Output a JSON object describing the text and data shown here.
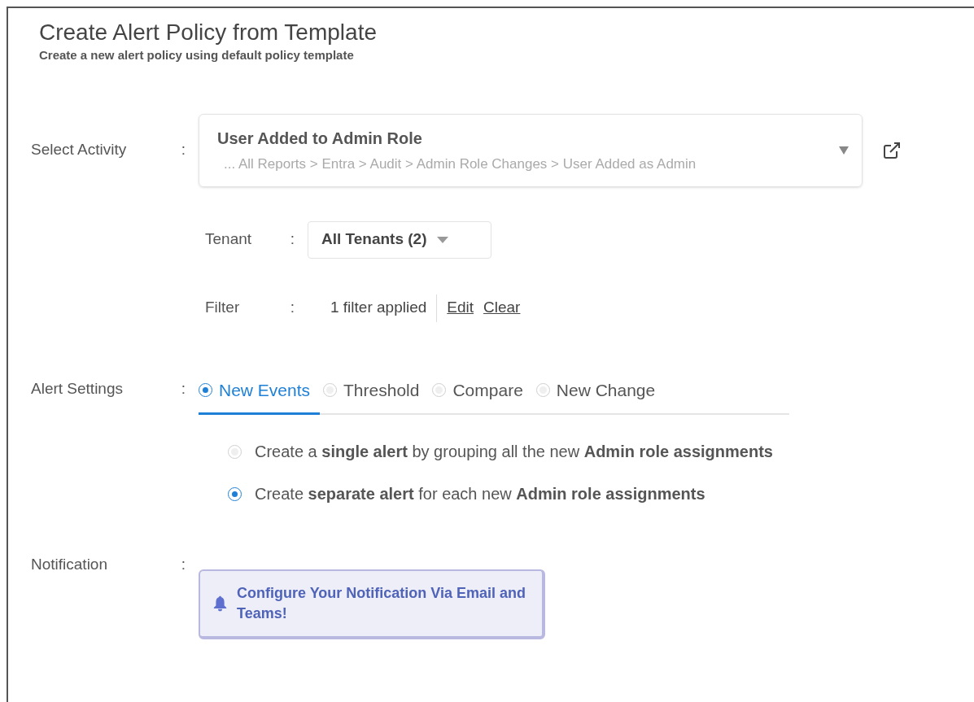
{
  "header": {
    "title": "Create Alert Policy from Template",
    "subtitle": "Create a new alert policy using default policy template"
  },
  "select_activity": {
    "label": "Select Activity",
    "colon": ":",
    "value": "User Added to Admin Role",
    "path": "... All Reports > Entra > Audit > Admin Role Changes > User Added as Admin"
  },
  "tenant": {
    "label": "Tenant",
    "colon": ":",
    "value": "All Tenants (2)"
  },
  "filter": {
    "label": "Filter",
    "colon": ":",
    "summary": "1 filter applied",
    "links": [
      "Edit",
      "Clear"
    ]
  },
  "alert_settings": {
    "label": "Alert Settings",
    "colon": ":",
    "tabs": [
      {
        "label": "New Events",
        "selected": true
      },
      {
        "label": "Threshold",
        "selected": false
      },
      {
        "label": "Compare",
        "selected": false
      },
      {
        "label": "New Change",
        "selected": false
      }
    ],
    "options": [
      {
        "text": "Create a **single alert** by grouping all the new **Admin role assignments**",
        "selected": false
      },
      {
        "text": "Create **separate alert** for each new **Admin role assignments**",
        "selected": true
      }
    ]
  },
  "notification": {
    "label": "Notification",
    "colon": ":",
    "button": "Configure Your Notification Via Email and Teams!"
  }
}
